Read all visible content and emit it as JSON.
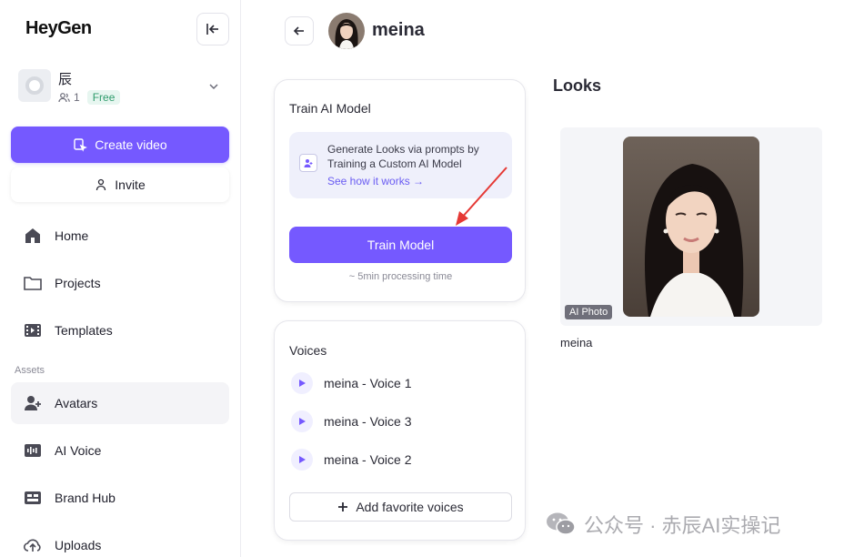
{
  "brand": {
    "logo_text": "HeyGen",
    "accent": "#7559ff"
  },
  "workspace": {
    "name": "辰",
    "members": "1",
    "plan": "Free"
  },
  "sidebar": {
    "create_label": "Create video",
    "invite_label": "Invite",
    "items": [
      {
        "label": "Home",
        "icon": "home-icon"
      },
      {
        "label": "Projects",
        "icon": "folder-icon"
      },
      {
        "label": "Templates",
        "icon": "film-icon"
      }
    ],
    "assets_label": "Assets",
    "asset_items": [
      {
        "label": "Avatars",
        "icon": "avatar-icon",
        "active": true
      },
      {
        "label": "AI Voice",
        "icon": "voice-icon"
      },
      {
        "label": "Brand Hub",
        "icon": "brand-icon"
      },
      {
        "label": "Uploads",
        "icon": "upload-icon"
      }
    ]
  },
  "header": {
    "title": "meina"
  },
  "train": {
    "title": "Train AI Model",
    "info_text": "Generate Looks via prompts by Training a Custom AI Model",
    "info_link": "See how it works →",
    "button_label": "Train Model",
    "processing_time": "~ 5min processing time"
  },
  "voices": {
    "title": "Voices",
    "items": [
      "meina - Voice 1",
      "meina - Voice 3",
      "meina - Voice 2"
    ],
    "add_label": "Add favorite voices"
  },
  "looks": {
    "title": "Looks",
    "items": [
      {
        "name": "meina",
        "badge": "AI Photo"
      }
    ]
  },
  "watermark": {
    "text": "公众号 · 赤辰AI实操记"
  }
}
